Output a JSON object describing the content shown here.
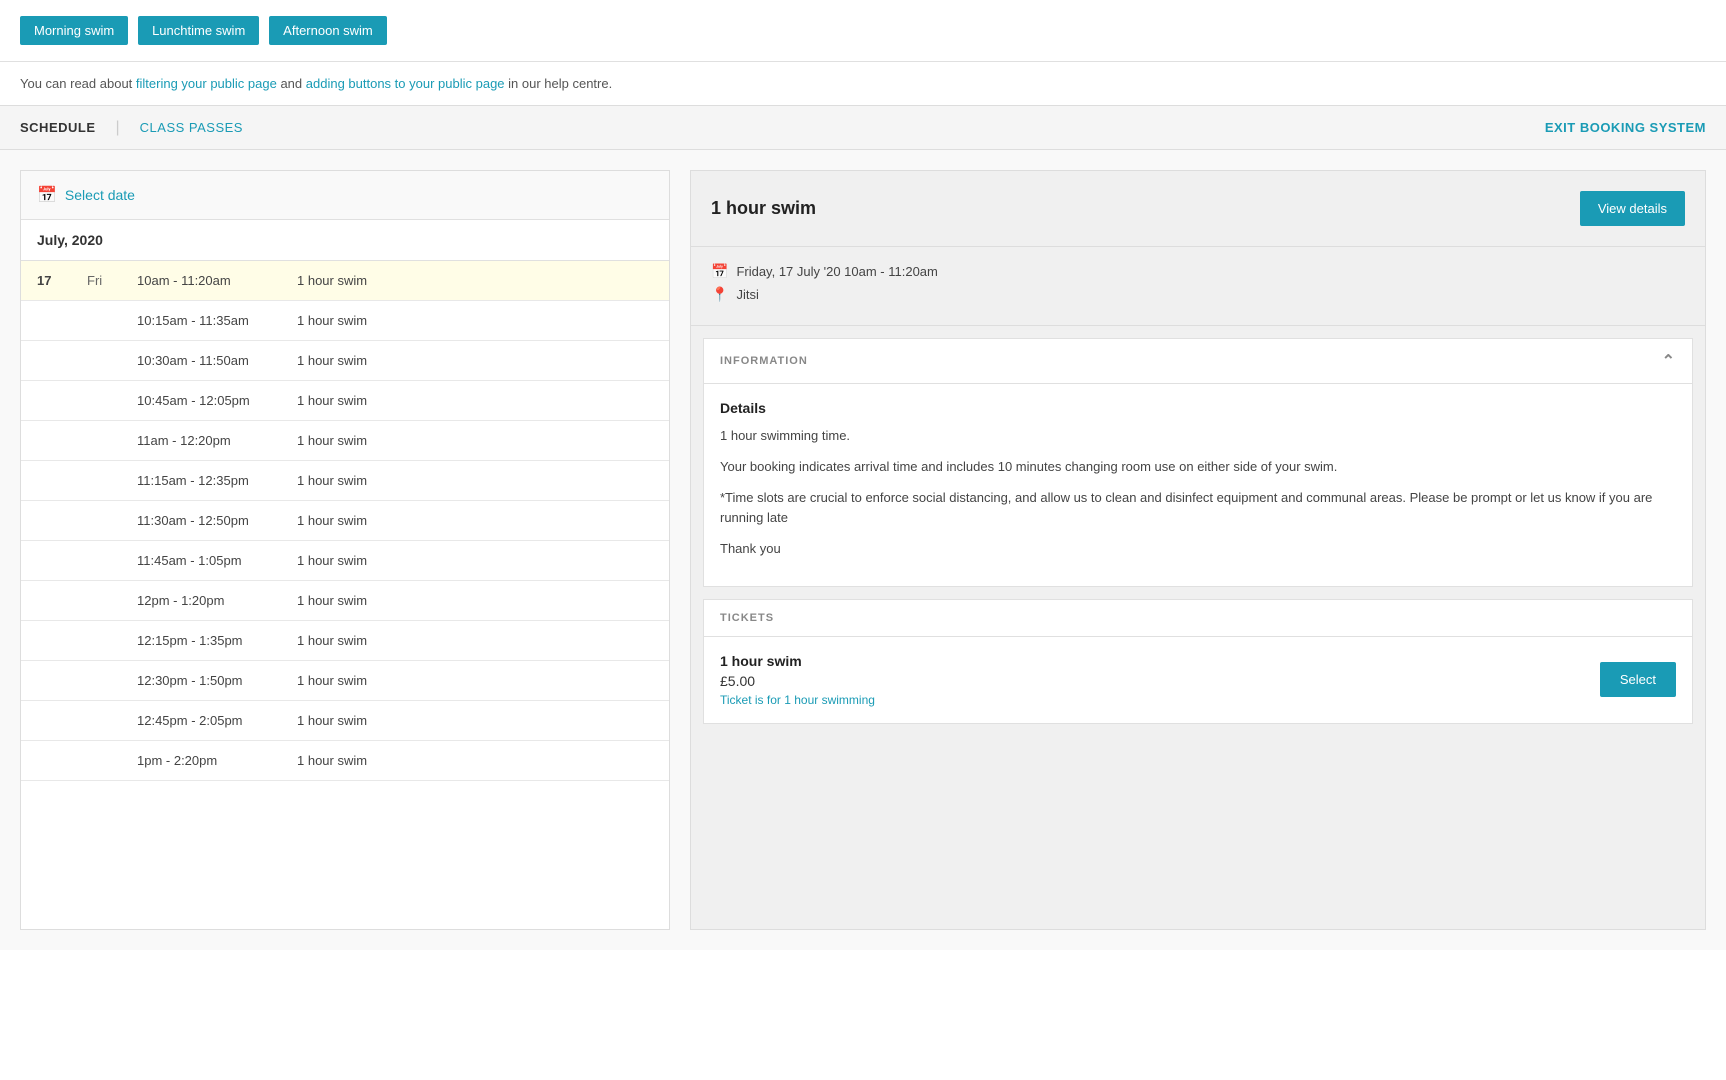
{
  "filter_buttons": [
    {
      "id": "morning-swim",
      "label": "Morning swim"
    },
    {
      "id": "lunchtime-swim",
      "label": "Lunchtime swim"
    },
    {
      "id": "afternoon-swim",
      "label": "Afternoon swim"
    }
  ],
  "help_text": {
    "prefix": "You can read about ",
    "link1_text": "filtering your public page",
    "middle": " and ",
    "link2_text": "adding buttons to your public page",
    "suffix": " in our help centre."
  },
  "nav": {
    "schedule_label": "SCHEDULE",
    "class_passes_label": "CLASS PASSES",
    "exit_label": "EXIT BOOKING SYSTEM"
  },
  "schedule": {
    "select_date_label": "Select date",
    "month_header": "July, 2020",
    "rows": [
      {
        "day_num": "17",
        "day_name": "Fri",
        "time": "10am - 11:20am",
        "class": "1 hour swim",
        "highlighted": true
      },
      {
        "day_num": "",
        "day_name": "",
        "time": "10:15am - 11:35am",
        "class": "1 hour swim",
        "highlighted": false
      },
      {
        "day_num": "",
        "day_name": "",
        "time": "10:30am - 11:50am",
        "class": "1 hour swim",
        "highlighted": false
      },
      {
        "day_num": "",
        "day_name": "",
        "time": "10:45am - 12:05pm",
        "class": "1 hour swim",
        "highlighted": false
      },
      {
        "day_num": "",
        "day_name": "",
        "time": "11am - 12:20pm",
        "class": "1 hour swim",
        "highlighted": false
      },
      {
        "day_num": "",
        "day_name": "",
        "time": "11:15am - 12:35pm",
        "class": "1 hour swim",
        "highlighted": false
      },
      {
        "day_num": "",
        "day_name": "",
        "time": "11:30am - 12:50pm",
        "class": "1 hour swim",
        "highlighted": false
      },
      {
        "day_num": "",
        "day_name": "",
        "time": "11:45am - 1:05pm",
        "class": "1 hour swim",
        "highlighted": false
      },
      {
        "day_num": "",
        "day_name": "",
        "time": "12pm - 1:20pm",
        "class": "1 hour swim",
        "highlighted": false
      },
      {
        "day_num": "",
        "day_name": "",
        "time": "12:15pm - 1:35pm",
        "class": "1 hour swim",
        "highlighted": false
      },
      {
        "day_num": "",
        "day_name": "",
        "time": "12:30pm - 1:50pm",
        "class": "1 hour swim",
        "highlighted": false
      },
      {
        "day_num": "",
        "day_name": "",
        "time": "12:45pm - 2:05pm",
        "class": "1 hour swim",
        "highlighted": false
      },
      {
        "day_num": "",
        "day_name": "",
        "time": "1pm - 2:20pm",
        "class": "1 hour swim",
        "highlighted": false
      }
    ]
  },
  "detail_panel": {
    "title": "1 hour swim",
    "view_details_label": "View details",
    "date_time": "Friday, 17 July '20   10am - 11:20am",
    "location": "Jitsi",
    "information_label": "INFORMATION",
    "details_title": "Details",
    "details_lines": [
      "1 hour swimming time.",
      "Your booking indicates arrival time and includes 10 minutes changing room use on either side of your swim.",
      "*Time slots are crucial to enforce social distancing, and allow us to clean and disinfect equipment and communal areas. Please be prompt or let us know if you are running late",
      "Thank you"
    ],
    "tickets_label": "TICKETS",
    "ticket_name": "1 hour swim",
    "ticket_price": "£5.00",
    "ticket_note": "Ticket is for 1 hour swimming",
    "select_label": "Select"
  }
}
